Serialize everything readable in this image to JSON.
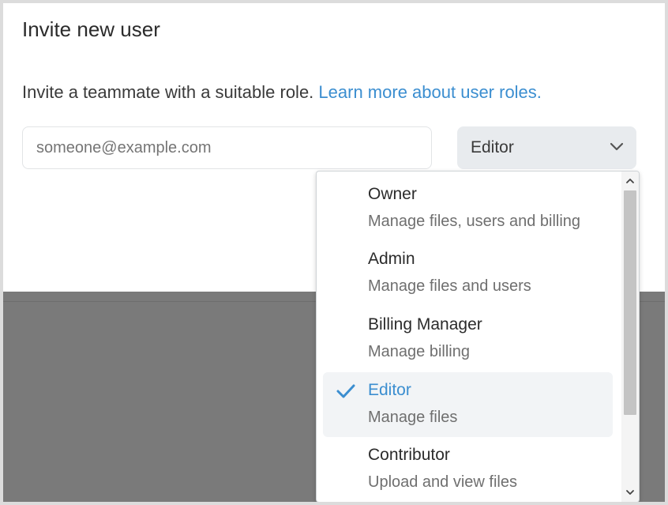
{
  "dialog": {
    "title": "Invite new user",
    "description": "Invite a teammate with a suitable role.",
    "learn_more_link": "Learn more about user roles."
  },
  "email_input": {
    "value": "",
    "placeholder": "someone@example.com"
  },
  "role_select": {
    "selected": "Editor",
    "chevron_icon": "chevron-down-icon"
  },
  "role_options": [
    {
      "name": "Owner",
      "description": "Manage files, users and billing",
      "selected": false
    },
    {
      "name": "Admin",
      "description": "Manage files and users",
      "selected": false
    },
    {
      "name": "Billing Manager",
      "description": "Manage billing",
      "selected": false
    },
    {
      "name": "Editor",
      "description": "Manage files",
      "selected": true
    },
    {
      "name": "Contributor",
      "description": "Upload and view files",
      "selected": false
    }
  ],
  "colors": {
    "accent": "#3b8ed0",
    "select_bg": "#e8ebee",
    "overlay": "#7a7a7a"
  }
}
